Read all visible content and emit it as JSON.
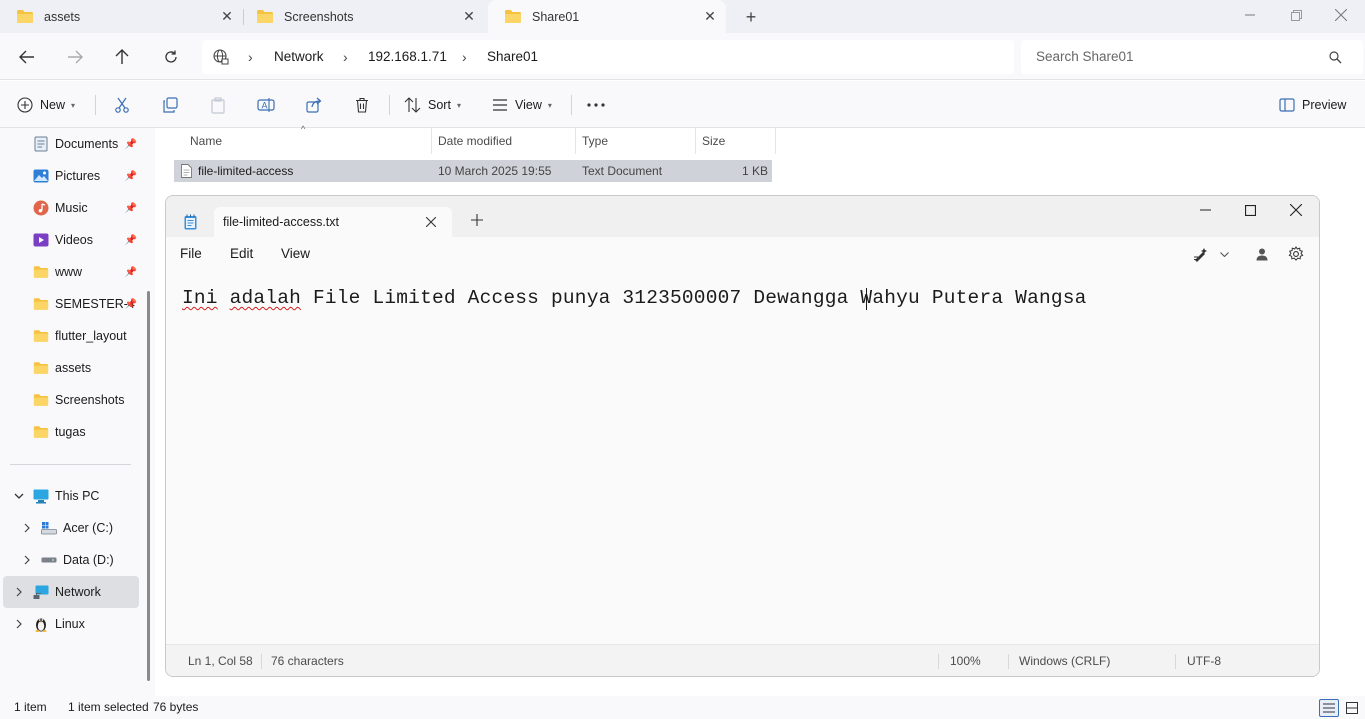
{
  "tabs": [
    {
      "label": "assets",
      "icon": "folder-icon"
    },
    {
      "label": "Screenshots",
      "icon": "folder-icon"
    },
    {
      "label": "Share01",
      "icon": "folder-icon",
      "active": true
    }
  ],
  "address": {
    "crumbs": [
      "Network",
      "192.168.1.71",
      "Share01"
    ],
    "search_placeholder": "Search Share01"
  },
  "toolbar": {
    "new_label": "New",
    "sort_label": "Sort",
    "view_label": "View",
    "preview_label": "Preview"
  },
  "sidebar": {
    "quick_access": [
      {
        "label": "Documents",
        "icon": "documents-icon",
        "pinned": true
      },
      {
        "label": "Pictures",
        "icon": "pictures-icon",
        "pinned": true
      },
      {
        "label": "Music",
        "icon": "music-icon",
        "pinned": true
      },
      {
        "label": "Videos",
        "icon": "videos-icon",
        "pinned": true
      },
      {
        "label": "www",
        "icon": "folder-icon",
        "pinned": true
      },
      {
        "label": "SEMESTER-4",
        "icon": "folder-icon",
        "pinned": true
      },
      {
        "label": "flutter_layout",
        "icon": "folder-icon",
        "pinned": false
      },
      {
        "label": "assets",
        "icon": "folder-icon",
        "pinned": false
      },
      {
        "label": "Screenshots",
        "icon": "folder-icon",
        "pinned": false
      },
      {
        "label": "tugas",
        "icon": "folder-icon",
        "pinned": false
      }
    ],
    "this_pc": "This PC",
    "drives": [
      {
        "label": "Acer (C:)",
        "icon": "windows-drive-icon"
      },
      {
        "label": "Data (D:)",
        "icon": "drive-icon"
      }
    ],
    "network": "Network",
    "linux": "Linux"
  },
  "files": {
    "columns": [
      "Name",
      "Date modified",
      "Type",
      "Size"
    ],
    "rows": [
      {
        "name": "file-limited-access",
        "date": "10 March 2025 19:55",
        "type": "Text Document",
        "size": "1 KB"
      }
    ]
  },
  "status": {
    "count": "1 item",
    "selected": "1 item selected",
    "size": "76 bytes"
  },
  "notepad": {
    "tab_title": "file-limited-access.txt",
    "menu": [
      "File",
      "Edit",
      "View"
    ],
    "text_word1": "Ini",
    "text_word2": "adalah",
    "text_rest": " File Limited Access punya 3123500007 Dewangga Wahyu Putera Wangsa",
    "status": {
      "position": "Ln 1, Col 58",
      "chars": "76 characters",
      "zoom": "100%",
      "line_ending": "Windows (CRLF)",
      "encoding": "UTF-8"
    }
  },
  "colors": {
    "folder": "#f5c342",
    "accent": "#3a6fb3",
    "selection": "#cfd2d8"
  }
}
